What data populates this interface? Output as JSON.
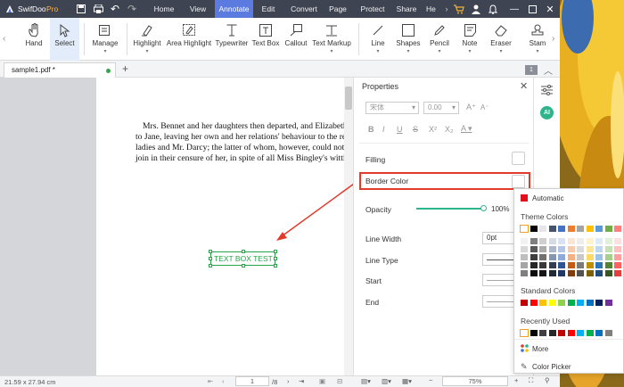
{
  "colors": {
    "accent": "#5b7be0",
    "titlebar": "#3f4452",
    "arrow": "#e23b2a",
    "textbox_green": "#2aa44a",
    "ai_badge": "#2fb58b"
  },
  "app": {
    "name": "SwifDoo",
    "edition": "Pro"
  },
  "menu": [
    "Home",
    "View",
    "Annotate",
    "Edit",
    "Convert",
    "Page",
    "Protect",
    "Share",
    "He"
  ],
  "menu_active": "Annotate",
  "tools": [
    {
      "label": "Hand",
      "icon": "hand-icon"
    },
    {
      "label": "Select",
      "icon": "cursor-icon",
      "selected": true
    },
    {
      "label": "Manage",
      "icon": "manage-icon",
      "dropdown": true
    },
    {
      "label": "Highlight",
      "icon": "highlight-icon",
      "dropdown": true
    },
    {
      "label": "Area Highlight",
      "icon": "area-highlight-icon"
    },
    {
      "label": "Typewriter",
      "icon": "typewriter-icon"
    },
    {
      "label": "Text Box",
      "icon": "textbox-icon"
    },
    {
      "label": "Callout",
      "icon": "callout-icon"
    },
    {
      "label": "Text Markup",
      "icon": "text-markup-icon",
      "dropdown": true
    },
    {
      "label": "Line",
      "icon": "line-icon",
      "dropdown": true
    },
    {
      "label": "Shapes",
      "icon": "shapes-icon",
      "dropdown": true
    },
    {
      "label": "Pencil",
      "icon": "pencil-icon",
      "dropdown": true
    },
    {
      "label": "Note",
      "icon": "note-icon",
      "dropdown": true
    },
    {
      "label": "Eraser",
      "icon": "eraser-icon",
      "dropdown": true
    },
    {
      "label": "Stam",
      "icon": "stamp-icon",
      "dropdown": true
    }
  ],
  "tab": {
    "name": "sample1.pdf *",
    "page_counter": "1"
  },
  "document": {
    "lines": [
      "Mrs. Bennet and her daughters then departed, and Elizabeth re",
      "to Jane, leaving her own and her relations' behaviour to the rem",
      "ladies and Mr. Darcy; the latter of whom, however, could not be",
      "join in their censure of her, in spite of all Miss Bingley's witticism"
    ],
    "textbox": "TEXT BOX TEST"
  },
  "properties": {
    "title": "Properties",
    "font": "宋体",
    "size": "0.00",
    "filling": "Filling",
    "border_color": "Border Color",
    "opacity": "Opacity",
    "opacity_value": "100%",
    "opacity_level": 1.0,
    "line_width": "Line Width",
    "line_width_value": "0pt",
    "line_type": "Line Type",
    "start": "Start",
    "end": "End"
  },
  "color_popup": {
    "automatic": "Automatic",
    "theme_title": "Theme Colors",
    "theme_top": [
      "#ffffff",
      "#000000",
      "#e7e6e6",
      "#44546a",
      "#4472c4",
      "#ed7d31",
      "#a5a5a5",
      "#ffc000",
      "#5b9bd5",
      "#70ad47",
      "#ff7f7f"
    ],
    "theme_grid": [
      [
        "#f2f2f2",
        "#7f7f7f",
        "#d0cece",
        "#d6dce4",
        "#d9e2f3",
        "#fbe5d5",
        "#ededed",
        "#fff2cc",
        "#deebf6",
        "#e2efd9",
        "#ffe0e0"
      ],
      [
        "#d8d8d8",
        "#595959",
        "#aeabab",
        "#adb9ca",
        "#b4c6e7",
        "#f7cbac",
        "#dbdbdb",
        "#fee599",
        "#bdd7ee",
        "#c5e0b3",
        "#ffc0c0"
      ],
      [
        "#bfbfbf",
        "#3f3f3f",
        "#757070",
        "#8496b0",
        "#8eaadb",
        "#f4b183",
        "#c9c9c9",
        "#ffd965",
        "#9dc3e6",
        "#a8d08d",
        "#ffa0a0"
      ],
      [
        "#a5a5a5",
        "#262626",
        "#3a3838",
        "#323f4f",
        "#2f5496",
        "#c55a11",
        "#7b7b7b",
        "#bf8f00",
        "#2e75b5",
        "#538135",
        "#ff6060"
      ],
      [
        "#7f7f7f",
        "#0c0c0c",
        "#171616",
        "#222a35",
        "#1f3864",
        "#833c0b",
        "#525252",
        "#7f6000",
        "#1e4e79",
        "#375623",
        "#e04040"
      ]
    ],
    "standard_title": "Standard Colors",
    "standard": [
      "#c00000",
      "#ff0000",
      "#ffc000",
      "#ffff00",
      "#92d050",
      "#00b050",
      "#00b0f0",
      "#0070c0",
      "#002060",
      "#7030a0"
    ],
    "recent_title": "Recently Used",
    "recent": [
      "#ffffff",
      "#000000",
      "#3f3f3f",
      "#262626",
      "#c00000",
      "#ff0000",
      "#00b0f0",
      "#00b050",
      "#0070c0",
      "#7f7f7f"
    ],
    "more": "More",
    "picker": "Color Picker"
  },
  "status": {
    "page_size": "21.59 x 27.94 cm",
    "page": "1",
    "total": "/8",
    "zoom": "75%"
  }
}
